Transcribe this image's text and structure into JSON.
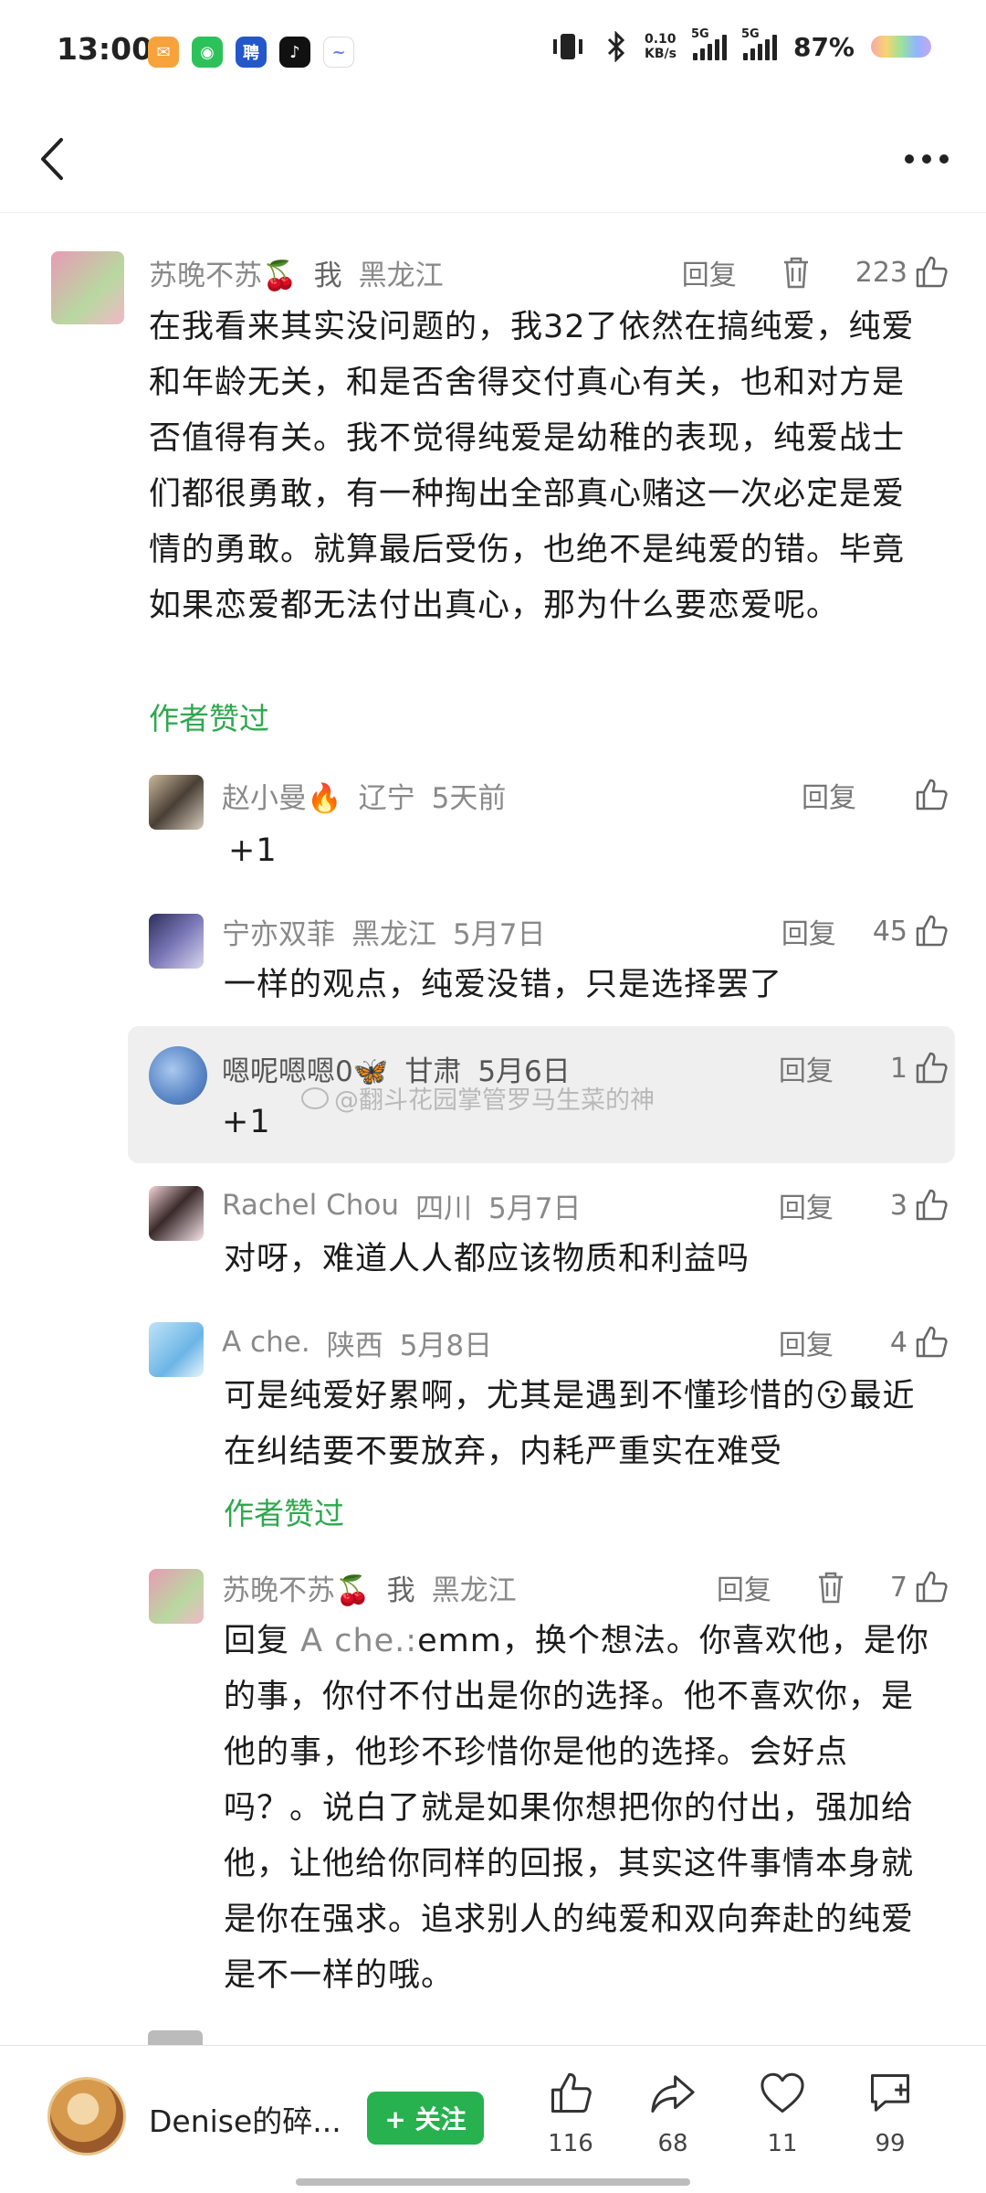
{
  "status_bar": {
    "time": "13:00",
    "net_speed_value": "0.10",
    "net_speed_unit": "KB/s",
    "signal_label_1": "5G",
    "signal_label_2": "5G",
    "battery": "87%"
  },
  "header": {
    "back_icon": "chevron-left-icon",
    "more_icon": "more-dots-icon"
  },
  "comments": [
    {
      "name": "苏晚不苏🍒",
      "me": "我",
      "location": "黑龙江",
      "reply_label": "回复",
      "likes": "223",
      "text": "在我看来其实没问题的，我32了依然在搞纯爱，纯爱和年龄无关，和是否舍得交付真心有关，也和对方是否值得有关。我不觉得纯爱是幼稚的表现，纯爱战士们都很勇敢，有一种掏出全部真心赌这一次必定是爱情的勇敢。就算最后受伤，也绝不是纯爱的错。毕竟如果恋爱都无法付出真心，那为什么要恋爱呢。",
      "author_liked": "作者赞过"
    },
    {
      "name": "赵小曼🔥",
      "location": "辽宁",
      "time": "5天前",
      "reply_label": "回复",
      "likes": "",
      "text": "+1"
    },
    {
      "name": "宁亦双菲",
      "location": "黑龙江",
      "time": "5月7日",
      "reply_label": "回复",
      "likes": "45",
      "text": "一样的观点，纯爱没错，只是选择罢了"
    },
    {
      "name": "嗯呢嗯嗯0🦋",
      "location": "甘肃",
      "time": "5月6日",
      "reply_label": "回复",
      "likes": "1",
      "text": "+1"
    },
    {
      "name": "Rachel Chou",
      "location": "四川",
      "time": "5月7日",
      "reply_label": "回复",
      "likes": "3",
      "text": "对呀，难道人人都应该物质和利益吗"
    },
    {
      "name": "A che.",
      "location": "陕西",
      "time": "5月8日",
      "reply_label": "回复",
      "likes": "4",
      "text": "可是纯爱好累啊，尤其是遇到不懂珍惜的😗最近在纠结要不要放弃，内耗严重实在难受",
      "author_liked": "作者赞过"
    },
    {
      "name": "苏晚不苏🍒",
      "me": "我",
      "location": "黑龙江",
      "reply_label": "回复",
      "likes": "7",
      "reply_prefix": "回复",
      "reply_target": "A che.:",
      "text": "emm，换个想法。你喜欢他，是你的事，你付不付出是你的选择。他不喜欢你，是他的事，他珍不珍惜你是他的选择。会好点吗？。说白了就是如果你想把你的付出，强加给他，让他给你同样的回报，其实这件事情本身就是你在强求。追求别人的纯爱和双向奔赴的纯爱是不一样的哦。"
    }
  ],
  "watermark": "@翻斗花园掌管罗马生菜的神",
  "bottom_bar": {
    "author_name": "Denise的碎...",
    "follow_label": "+ 关注",
    "like_count": "116",
    "share_count": "68",
    "fav_count": "11",
    "comment_count": "99"
  },
  "colors": {
    "accent_green": "#2fa84f",
    "follow_button": "#27b14f",
    "secondary_text": "#8a8a8a"
  }
}
